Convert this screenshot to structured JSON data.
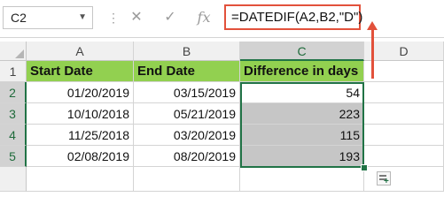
{
  "name_box": {
    "value": "C2"
  },
  "formula_bar": {
    "formula": "=DATEDIF(A2,B2,\"D\")",
    "icons": [
      "close-icon",
      "check-icon",
      "function-icon"
    ]
  },
  "columns": [
    "A",
    "B",
    "C",
    "D"
  ],
  "rows": [
    "1",
    "2",
    "3",
    "4",
    "5"
  ],
  "header": {
    "a": "Start Date",
    "b": "End Date",
    "c": "Difference in days"
  },
  "data": [
    {
      "a": "01/20/2019",
      "b": "03/15/2019",
      "c": "54"
    },
    {
      "a": "10/10/2018",
      "b": "05/21/2019",
      "c": "223"
    },
    {
      "a": "11/25/2018",
      "b": "03/20/2019",
      "c": "115"
    },
    {
      "a": "02/08/2019",
      "b": "08/20/2019",
      "c": "193"
    }
  ],
  "colors": {
    "header_fill": "#92d050",
    "selection": "#217346",
    "arrow": "#e2513b",
    "selected_fill": "#c6c6c6"
  }
}
